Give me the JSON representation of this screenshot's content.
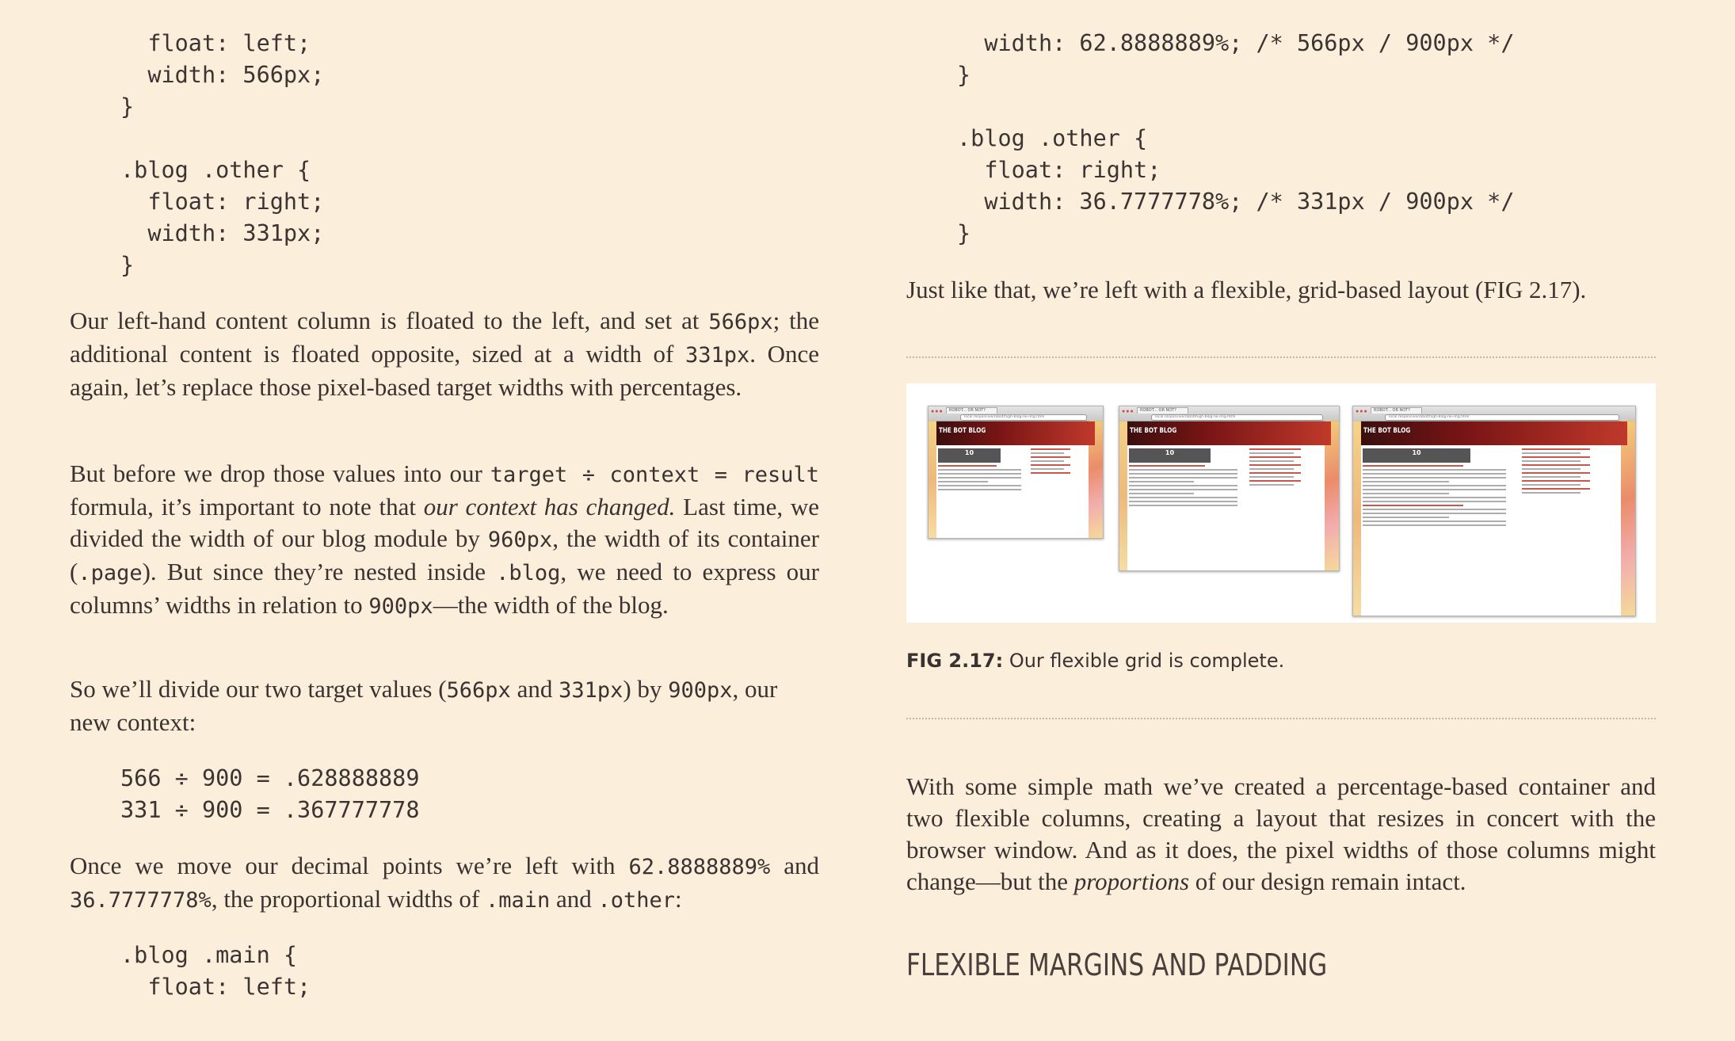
{
  "left": {
    "code_top": "  float: left;\n  width: 566px;\n}\n\n.blog .other {\n  float: right;\n  width: 331px;\n}",
    "para1": {
      "t1": "Our left-hand content column is floated to the left, and set at ",
      "c1": "566px",
      "t2": "; the additional content is floated opposite, sized at a width of ",
      "c2": "331px",
      "t3": ". Once again, let’s replace those pixel-based target widths with percentages."
    },
    "para2": {
      "t1": "But before we drop those values into our ",
      "c1": "target ÷ context = result",
      "t2": " formula, it’s important to note that ",
      "em1": "our context has changed.",
      "t3": " Last time, we divided the width of our blog module by ",
      "c2": "960px",
      "t4": ", the width of its container (",
      "c3": ".page",
      "t5": "). But since they’re nested inside ",
      "c4": ".blog",
      "t6": ", we need to express our columns’ widths in relation to ",
      "c5": "900px",
      "t7": "—the width of the blog."
    },
    "para3": {
      "t1": "So we’ll divide our two target values (",
      "c1": "566px",
      "t2": " and ",
      "c2": "331px",
      "t3": ") by ",
      "c3": "900px",
      "t4": ", our new context:"
    },
    "code_math": "566 ÷ 900 = .628888889\n331 ÷ 900 = .367777778",
    "para4": {
      "t1": "Once we move our decimal points we’re left with ",
      "c1": "62.8888889%",
      "t2": " and ",
      "c2": "36.7777778%",
      "t3": ", the proportional widths of ",
      "c3": ".main",
      "t4": " and ",
      "c4": ".other",
      "t5": ":"
    },
    "code_bottom": ".blog .main {\n  float: left;"
  },
  "right": {
    "code_top": "  width: 62.8888889%; /* 566px / 900px */\n}\n\n.blog .other {\n  float: right;\n  width: 36.7777778%; /* 331px / 900px */\n}",
    "para1": "Just like that, we’re left with a flexible, grid-based layout (FIG 2.17).",
    "figure": {
      "shots": [
        {
          "tab": "ROBOT... OR NOT?",
          "url": "local.responsive/robot/high-blog-no-img.html",
          "title": "THE BOT BLOG",
          "date": "10"
        },
        {
          "tab": "ROBOT... OR NOT?",
          "url": "local.responsive/robot/high-blog-no-img.html",
          "title": "THE BOT BLOG",
          "date": "10"
        },
        {
          "tab": "ROBOT... OR NOT?",
          "url": "local.responsive/robot/high-blog-no-img.html",
          "title": "THE BOT BLOG",
          "date": "10"
        }
      ]
    },
    "caption_label": "FIG 2.17:",
    "caption_text": " Our flexible grid is complete.",
    "para2": {
      "t1": "With some simple math we’ve created a percentage-based container and two flexible columns, creating a layout that resizes in concert with the browser window. And as it does, the pixel widths of those columns might change—but the ",
      "em1": "proportions",
      "t2": " of our design remain intact."
    },
    "heading": "FLEXIBLE MARGINS AND PADDING"
  }
}
